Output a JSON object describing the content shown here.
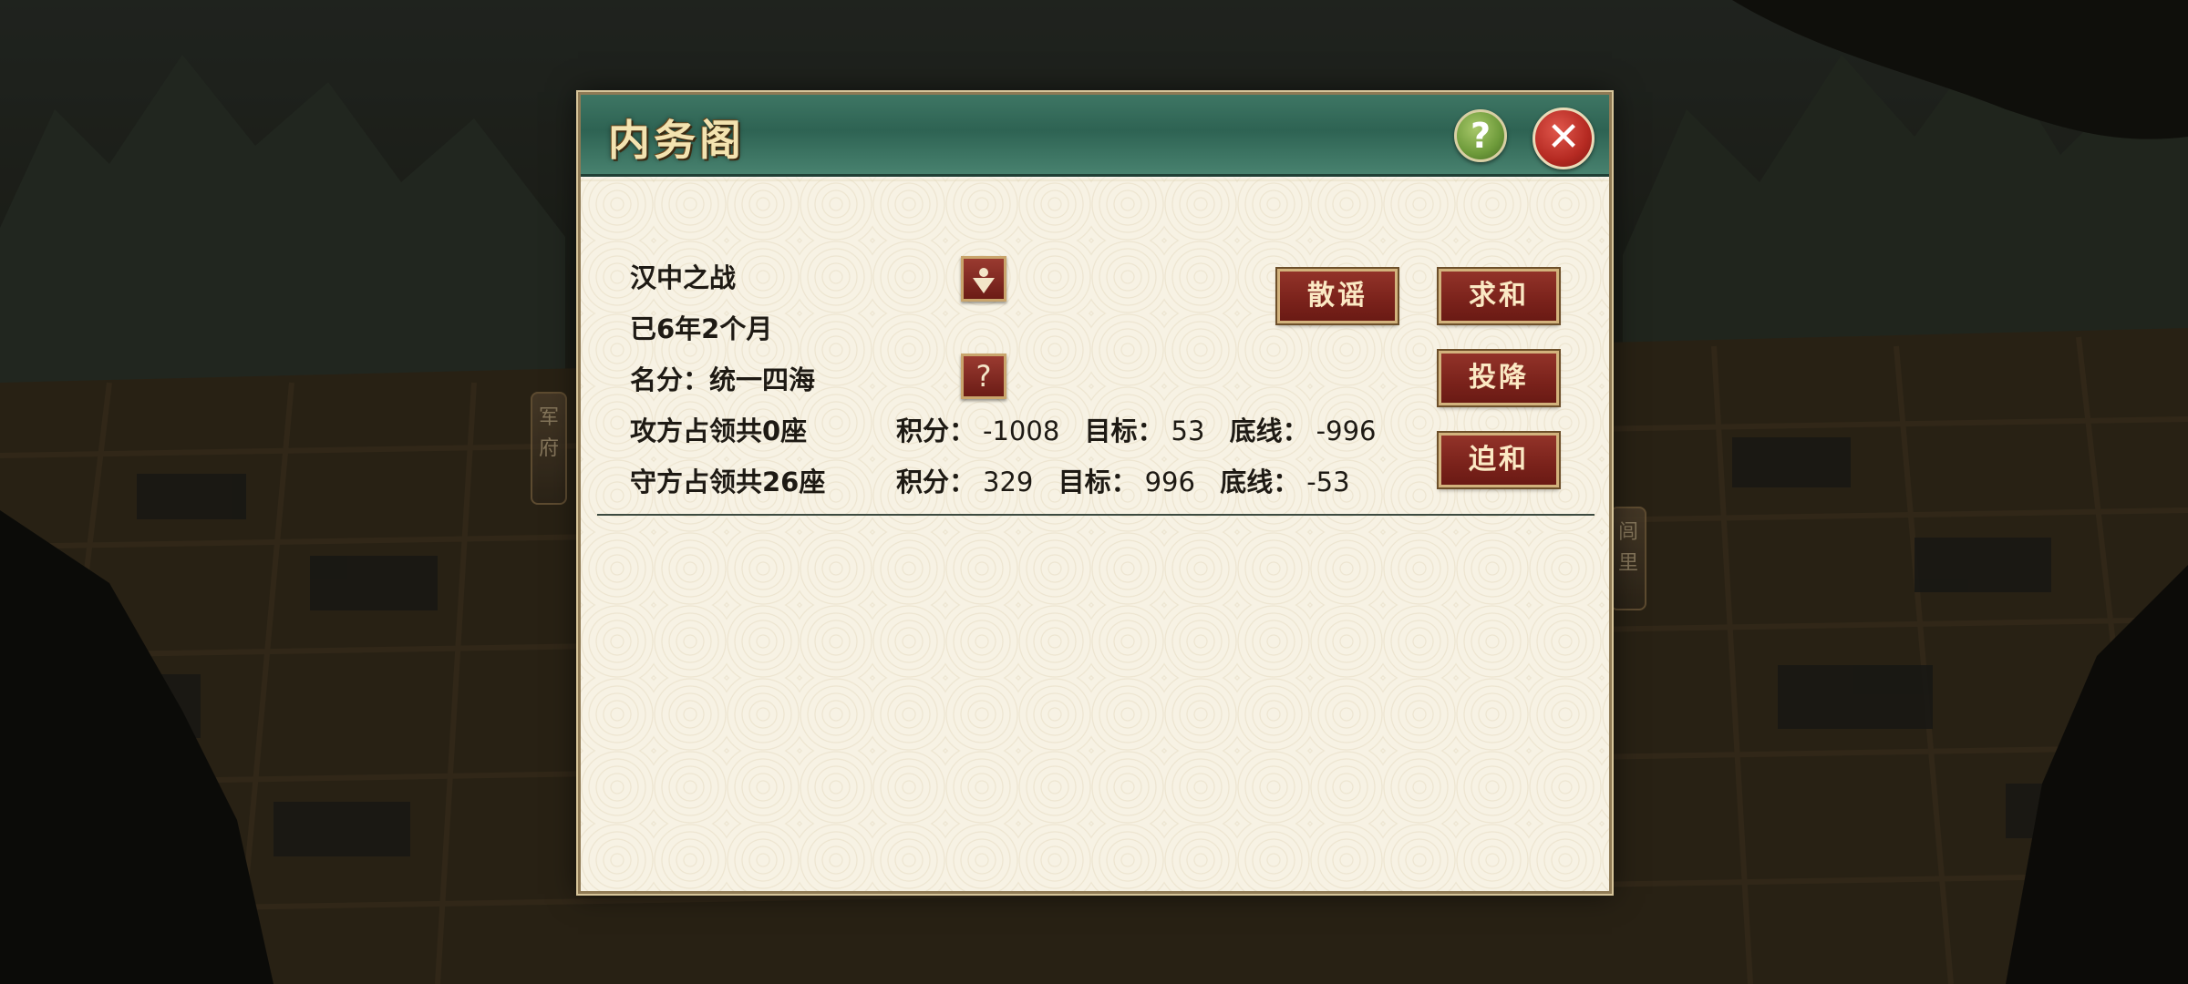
{
  "background": {
    "left_tab": "军府",
    "right_tab": "闾里"
  },
  "dialog": {
    "title": "内务阁",
    "help_symbol": "?",
    "close_symbol": "✕",
    "battle": {
      "name": "汉中之战",
      "duration": "已6年2个月",
      "title_line": "名分：统一四海",
      "info_symbol": "?"
    },
    "attacker": {
      "occupy": "攻方占领共0座",
      "score_label": "积分：",
      "score": "-1008",
      "target_label": "目标：",
      "target": "53",
      "floor_label": "底线：",
      "floor": "-996"
    },
    "defender": {
      "occupy": "守方占领共26座",
      "score_label": "积分：",
      "score": "329",
      "target_label": "目标：",
      "target": "996",
      "floor_label": "底线：",
      "floor": "-53"
    },
    "actions": {
      "rumor": "散谣",
      "peace": "求和",
      "surrender": "投降",
      "force_peace": "迫和"
    }
  },
  "colors": {
    "header_green": "#2e6353",
    "button_red": "#7a221b",
    "panel_bg": "#f7f2e4",
    "title_gold": "#f3e3b0"
  }
}
